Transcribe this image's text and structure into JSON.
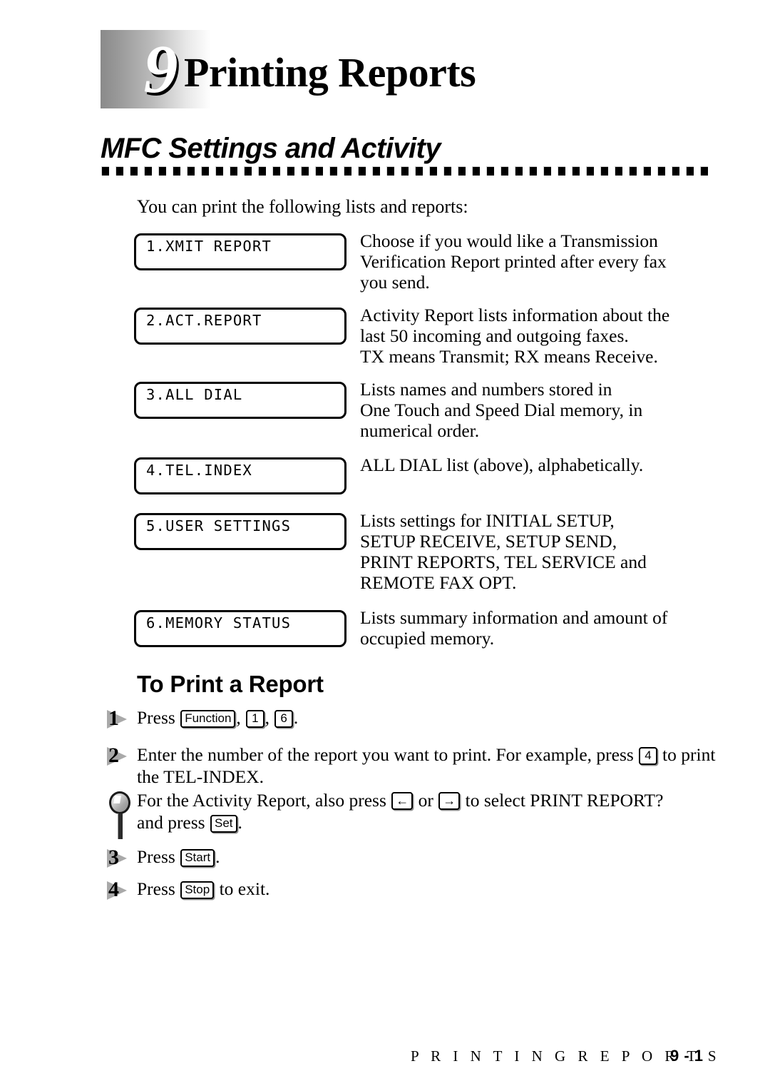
{
  "chapter": {
    "number": "9",
    "title": "Printing Reports"
  },
  "section": {
    "title": "MFC Settings and Activity",
    "intro": "You can print the following lists and reports:"
  },
  "reports": [
    {
      "lcd": "1.XMIT REPORT",
      "desc": [
        "Choose if you would like a Transmission",
        "Verification Report printed after every fax",
        "you send."
      ]
    },
    {
      "lcd": "2.ACT.REPORT",
      "desc": [
        "Activity Report lists information about the",
        "last 50 incoming and outgoing faxes.",
        "TX means Transmit; RX means Receive."
      ]
    },
    {
      "lcd": "3.ALL DIAL",
      "desc": [
        "Lists names and numbers stored in",
        "One Touch and Speed Dial memory, in",
        "numerical order."
      ]
    },
    {
      "lcd": "4.TEL.INDEX",
      "desc": [
        "ALL DIAL list (above), alphabetically."
      ]
    },
    {
      "lcd": "5.USER SETTINGS",
      "desc": [
        "Lists settings for INITIAL SETUP,",
        "SETUP RECEIVE, SETUP SEND,",
        "PRINT REPORTS, TEL SERVICE and",
        "REMOTE FAX OPT."
      ]
    },
    {
      "lcd": "6.MEMORY STATUS",
      "desc": [
        "Lists summary information and amount of",
        "occupied memory."
      ]
    }
  ],
  "procedure": {
    "heading": "To Print a Report",
    "steps": [
      {
        "number": "1",
        "text_before": "Press ",
        "keys": [
          "Function",
          "1",
          "6"
        ],
        "text_after": "."
      },
      {
        "number": "2",
        "text_before": "Enter the number of the report you want to print.  For example, press ",
        "keys": [
          "4"
        ],
        "text_after": " to print the TEL-INDEX."
      },
      {
        "number": "3",
        "text_before": "Press ",
        "keys": [
          "Start"
        ],
        "text_after": "."
      },
      {
        "number": "4",
        "text_before": "Press ",
        "keys": [
          "Stop"
        ],
        "text_after": " to exit."
      }
    ],
    "note": {
      "part1": "For the Activity Report, also press ",
      "key_left": "←",
      "part2": " or ",
      "key_right": "→",
      "part3": " to select PRINT REPORT?",
      "part4": "and press ",
      "key_set": "Set",
      "part5": "."
    }
  },
  "footer": {
    "title": "P R I N T I N G     R E P O R T S",
    "page": "9 - 1"
  }
}
